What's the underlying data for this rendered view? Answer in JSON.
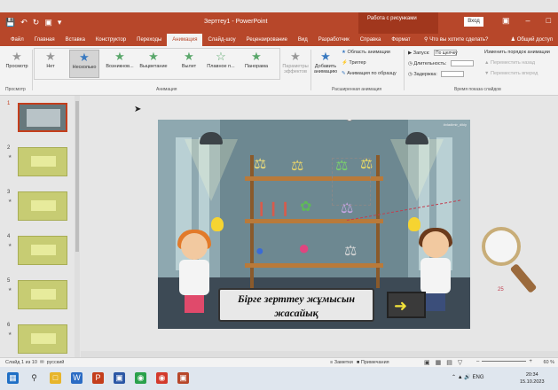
{
  "window": {
    "title": "Зерттеу1 - PowerPoint",
    "context_tab": "Работа с рисунками",
    "signin": "Вход"
  },
  "tabs": [
    "Файл",
    "Главная",
    "Вставка",
    "Конструктор",
    "Переходы",
    "Анимация",
    "Слайд-шоу",
    "Рецензирование",
    "Вид",
    "Разработчик",
    "Справка",
    "Формат"
  ],
  "active_tab": "Анимация",
  "tellme": "Что вы хотите сделать?",
  "share": "Общий доступ",
  "ribbon": {
    "preview_label": "Просмотр",
    "preview_group": "Просмотр",
    "gallery": [
      "Нет",
      "Несколько",
      "Возникнов...",
      "Выцветание",
      "Вылет",
      "Плавное п...",
      "Панорама"
    ],
    "effect_params": "Параметры эффектов",
    "animation_group": "Анимация",
    "add_animation": "Добавить анимацию",
    "anim_pane": "Область анимации",
    "trigger": "Триггер",
    "anim_painter": "Анимация по образцу",
    "advanced_group": "Расширенная анимация",
    "start_label": "Запуск:",
    "start_value": "По щелчку",
    "duration_label": "Длительность:",
    "delay_label": "Задержка:",
    "reorder_title": "Изменить порядок анимации",
    "move_earlier": "Переместить назад",
    "move_later": "Переместить вперед",
    "timing_group": "Время показа слайдов"
  },
  "slides": [
    "1",
    "2",
    "3",
    "4",
    "5",
    "6"
  ],
  "slide": {
    "banner_text": "Бірге зерттеу жұмысын жасайық",
    "watermark": "#vladimir_dikiy"
  },
  "motion_label": "25",
  "status": {
    "slide_info": "Слайд 1 из 10",
    "language": "русский",
    "notes": "Заметки",
    "comments": "Примечания",
    "zoom": "60 %"
  },
  "taskbar": {
    "lang": "ENG",
    "time": "20:34",
    "date": "15.10.2023"
  },
  "colors": {
    "accent": "#b7472a",
    "selection": "#c43e1c"
  }
}
